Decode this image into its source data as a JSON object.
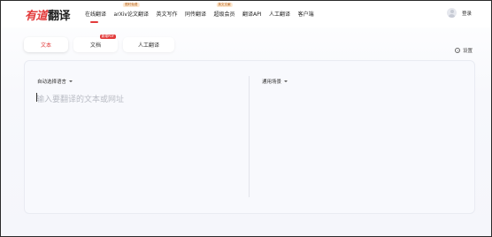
{
  "brand": {
    "logo_part1": "有道",
    "logo_part2": "翻译",
    "accent": "#e23b3b"
  },
  "nav": {
    "items": [
      {
        "label": "在线翻译",
        "badge": ""
      },
      {
        "label": "arXiv论文翻译",
        "badge": "限时免费"
      },
      {
        "label": "英文写作",
        "badge": ""
      },
      {
        "label": "同传翻译",
        "badge": ""
      },
      {
        "label": "超级会员",
        "badge": "英文文献"
      },
      {
        "label": "翻译API",
        "badge": ""
      },
      {
        "label": "人工翻译",
        "badge": ""
      },
      {
        "label": "客户端",
        "badge": ""
      }
    ]
  },
  "user": {
    "login_label": "登录"
  },
  "tabs": {
    "text": "文本",
    "doc": "文档",
    "doc_badge": "新增PDF",
    "human": "人工翻译"
  },
  "settings": {
    "label": "设置"
  },
  "editor": {
    "source_lang": "自动选择语言",
    "target_lang": "通用场景",
    "placeholder": "输入要翻译的文本或网址"
  }
}
